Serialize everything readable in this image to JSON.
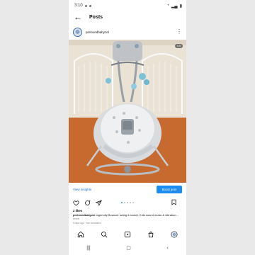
{
  "status": {
    "time": "3:10",
    "battery": "▮"
  },
  "appbar": {
    "title": "Posts"
  },
  "post": {
    "username": "prelovedbabyzel",
    "likes": "2 likes",
    "caption_user": "prelovedbabyzel",
    "caption_text": "Ingenuity Bouncer swing & rocker. Kids sound music & vibration...",
    "more": "more",
    "timestamp": "5 days ago · See translation"
  },
  "cta": {
    "view_insights": "View insights",
    "boost": "Boost post"
  },
  "colors": {
    "accent": "#1d8cf0",
    "link": "#1a6fd1"
  },
  "icons": [
    "heart-icon",
    "comment-icon",
    "share-icon",
    "bookmark-icon",
    "home-icon",
    "search-icon",
    "reels-icon",
    "shop-icon",
    "profile-icon"
  ]
}
